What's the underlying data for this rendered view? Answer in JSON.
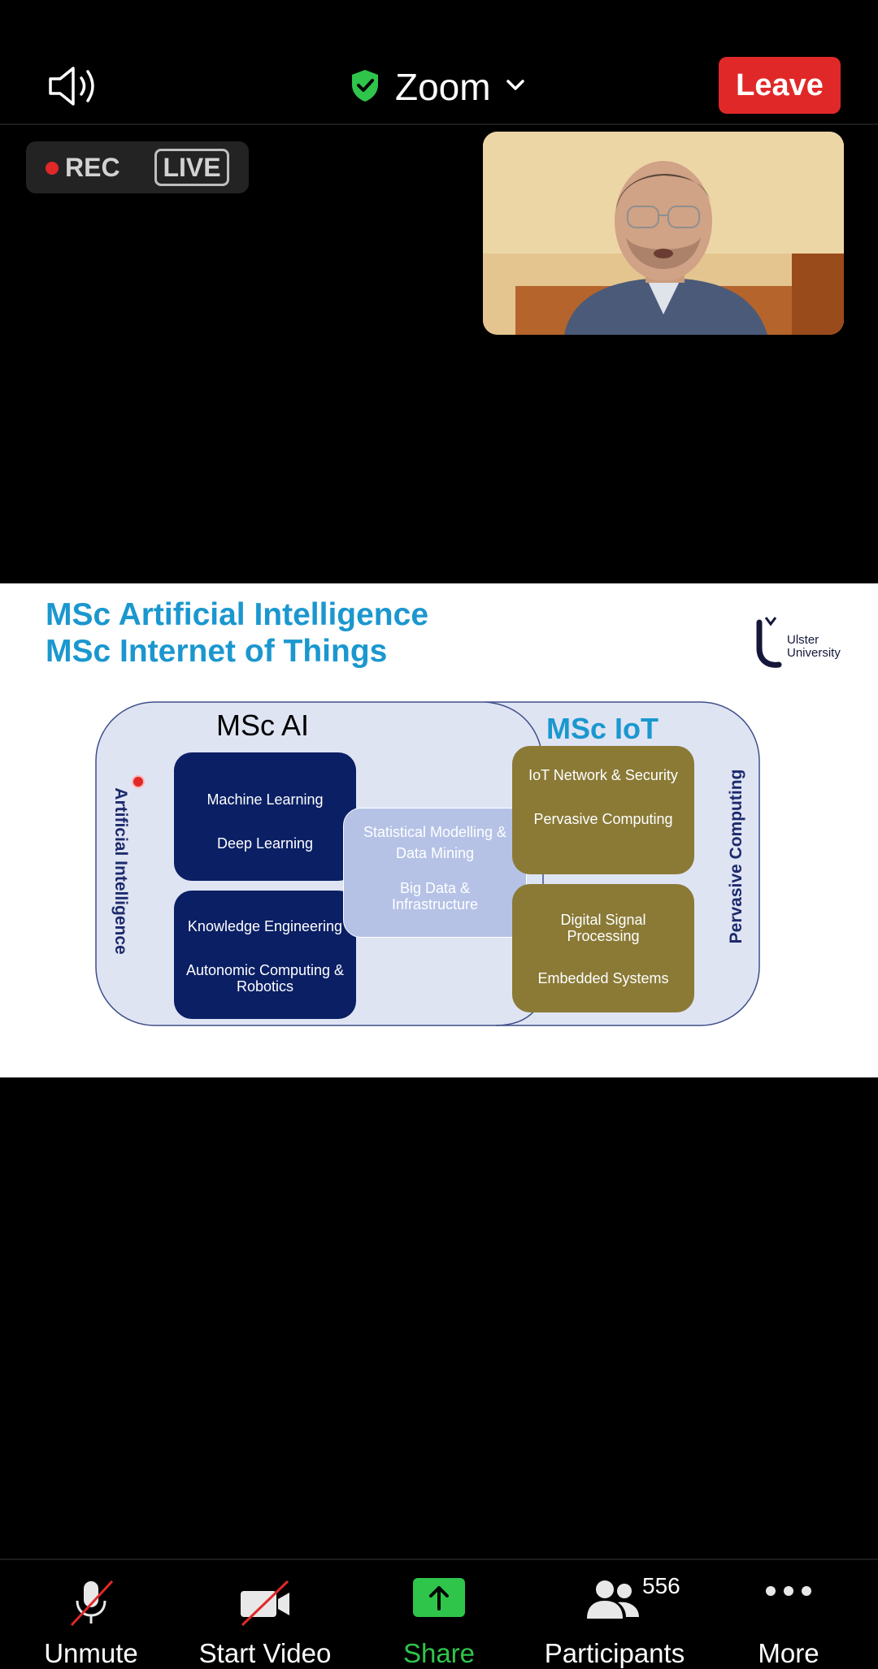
{
  "header": {
    "meeting_title": "Zoom",
    "leave_label": "Leave"
  },
  "recording": {
    "rec_label": "REC",
    "live_label": "LIVE"
  },
  "slide": {
    "title_line1": "MSc Artificial Intelligence",
    "title_line2": "MSc Internet of Things",
    "logo_line1": "Ulster",
    "logo_line2": "University",
    "msc_ai_label": "MSc AI",
    "msc_iot_label": "MSc IoT",
    "left_vertical": "Artificial Intelligence",
    "right_vertical": "Pervasive Computing",
    "box_ml": [
      "Machine Learning",
      "Deep Learning"
    ],
    "box_ke": [
      "Knowledge Engineering",
      "Autonomic Computing & Robotics"
    ],
    "box_center": [
      "Statistical Modelling & Data Mining",
      "Big Data & Infrastructure"
    ],
    "box_iot1": [
      "IoT Network & Security",
      "Pervasive Computing"
    ],
    "box_iot2": [
      "Digital Signal Processing",
      "Embedded Systems"
    ],
    "colors": {
      "title": "#1b97cf",
      "navy": "#0a1f64",
      "gold": "#8a7a36",
      "lavender": "#b5c2e6"
    }
  },
  "toolbar": {
    "unmute_label": "Unmute",
    "start_video_label": "Start Video",
    "share_label": "Share",
    "participants_label": "Participants",
    "participants_count": "556",
    "more_label": "More"
  },
  "icons": [
    "speaker-icon",
    "shield-check-icon",
    "chevron-down-icon",
    "mic-off-icon",
    "video-off-icon",
    "share-up-arrow-icon",
    "participants-icon",
    "more-dots-icon"
  ]
}
